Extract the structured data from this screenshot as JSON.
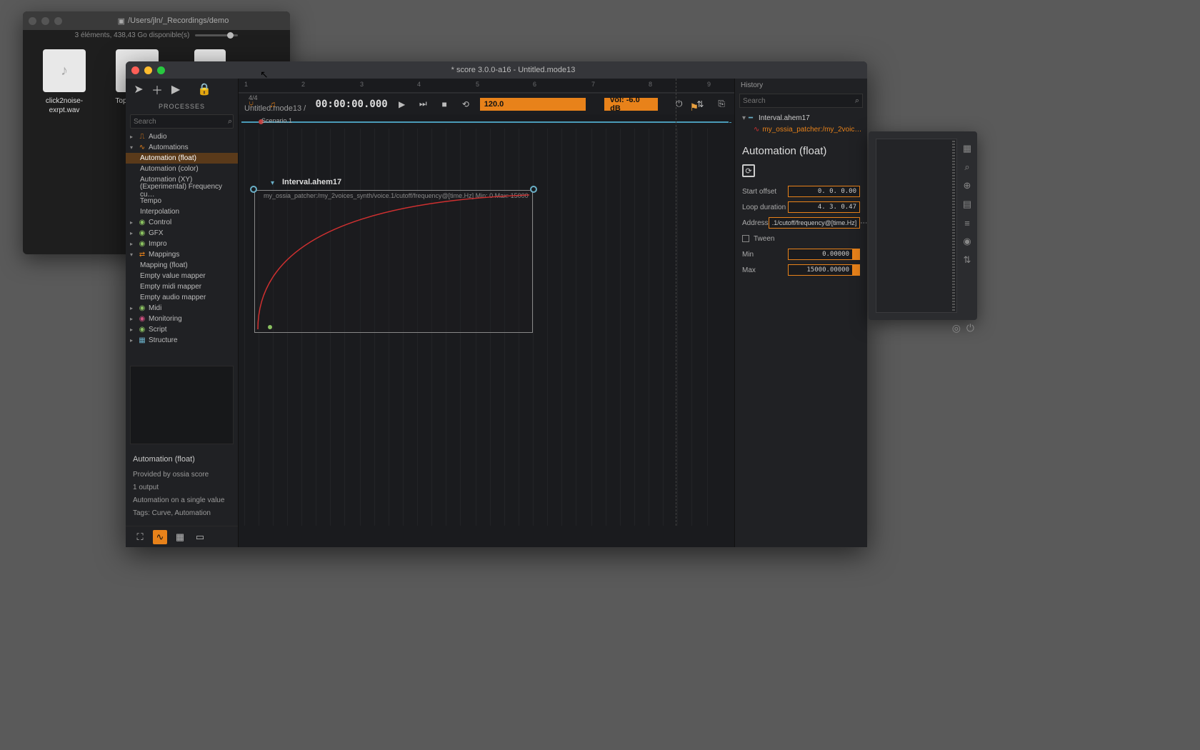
{
  "finder": {
    "path": "/Users/jln/_Recordings/demo",
    "status": "3 éléments, 438,43 Go disponible(s)",
    "files": [
      "click2noise-exrpt.wav",
      "Toppo mon-..."
    ]
  },
  "score": {
    "title": "* score 3.0.0-a16 - Untitled.mode13",
    "processes_header": "PROCESSES",
    "search_placeholder": "Search",
    "tree": {
      "audio": "Audio",
      "automations": "Automations",
      "automation_float": "Automation (float)",
      "automation_color": "Automation (color)",
      "automation_xy": "Automation (XY)",
      "freq_curve": "(Experimental) Frequency cu…",
      "tempo": "Tempo",
      "interpolation": "Interpolation",
      "control": "Control",
      "gfx": "GFX",
      "impro": "Impro",
      "mappings": "Mappings",
      "mapping_float": "Mapping (float)",
      "empty_value": "Empty value mapper",
      "empty_midi": "Empty midi mapper",
      "empty_audio": "Empty audio mapper",
      "midi": "Midi",
      "monitoring": "Monitoring",
      "script": "Script",
      "structure": "Structure"
    },
    "info": {
      "title": "Automation (float)",
      "provided": "Provided by ossia score",
      "outputs": "1 output",
      "desc": "Automation on a single value",
      "tags": "Tags: Curve, Automation"
    },
    "timeline": {
      "timesig": "4/4",
      "breadcrumb": "Untitled.mode13 /",
      "scenario": "Scenario.1",
      "ticks": [
        "1",
        "2",
        "3",
        "4",
        "5",
        "6",
        "7",
        "8",
        "9"
      ],
      "interval_name": "Interval.ahem17",
      "interval_desc": "my_ossia_patcher:/my_2voices_synth/voice.1/cutoff/frequency@[time.Hz]   Min: 0   Max: 15000"
    },
    "transport": {
      "timecode": "00:00:00.000",
      "tempo": "120.0",
      "volume": "vol: -6.0 dB"
    },
    "history": {
      "header": "History",
      "search_placeholder": "Search",
      "interval": "Interval.ahem17",
      "child": "my_ossia_patcher:/my_2voic…"
    },
    "props": {
      "title": "Automation (float)",
      "start_offset_label": "Start offset",
      "start_offset": "0.  0.  0.00",
      "loop_duration_label": "Loop duration",
      "loop_duration": "4.  3.  0.47",
      "address_label": "Address",
      "address": ".1/cutoff/frequency@[time.Hz]",
      "tween_label": "Tween",
      "min_label": "Min",
      "min": "0.00000",
      "max_label": "Max",
      "max": "15000.00000"
    }
  }
}
